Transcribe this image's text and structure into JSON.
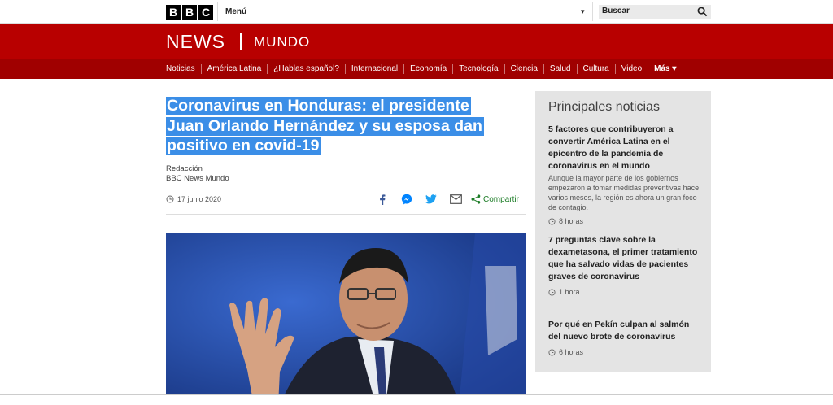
{
  "topbar": {
    "logo_letters": [
      "B",
      "B",
      "C"
    ],
    "menu_label": "Menú",
    "search_placeholder": "Buscar"
  },
  "brand": {
    "news": "NEWS",
    "mundo": "MUNDO"
  },
  "nav": {
    "items": [
      "Noticias",
      "América Latina",
      "¿Hablas español?",
      "Internacional",
      "Economía",
      "Tecnología",
      "Ciencia",
      "Salud",
      "Cultura",
      "Video"
    ],
    "more_label": "Más"
  },
  "article": {
    "headline_lines": [
      "Coronavirus en Honduras: el presidente",
      "Juan Orlando Hernández y su esposa dan",
      "positivo en covid-19"
    ],
    "byline_author": "Redacción",
    "byline_source": "BBC News Mundo",
    "date": "17 junio 2020",
    "share_label": "Compartir"
  },
  "sidebar": {
    "title": "Principales noticias",
    "stories": [
      {
        "title": "5 factores que contribuyeron a convertir América Latina en el epicentro de la pandemia de coronavirus en el mundo",
        "summary": "Aunque la mayor parte de los gobiernos empezaron a tomar medidas preventivas hace varios meses, la región es ahora un gran foco de contagio.",
        "time": "8 horas"
      },
      {
        "title": "7 preguntas clave sobre la dexametasona, el primer tratamiento que ha salvado vidas de pacientes graves de coronavirus",
        "summary": "",
        "time": "1 hora"
      },
      {
        "title": "Por qué en Pekín culpan al salmón del nuevo brote de coronavirus",
        "summary": "",
        "time": "6 horas"
      }
    ]
  },
  "colors": {
    "brand_red": "#b80000",
    "nav_red": "#a00000",
    "highlight": "#3b8ee7",
    "share_green": "#1d7d27"
  }
}
